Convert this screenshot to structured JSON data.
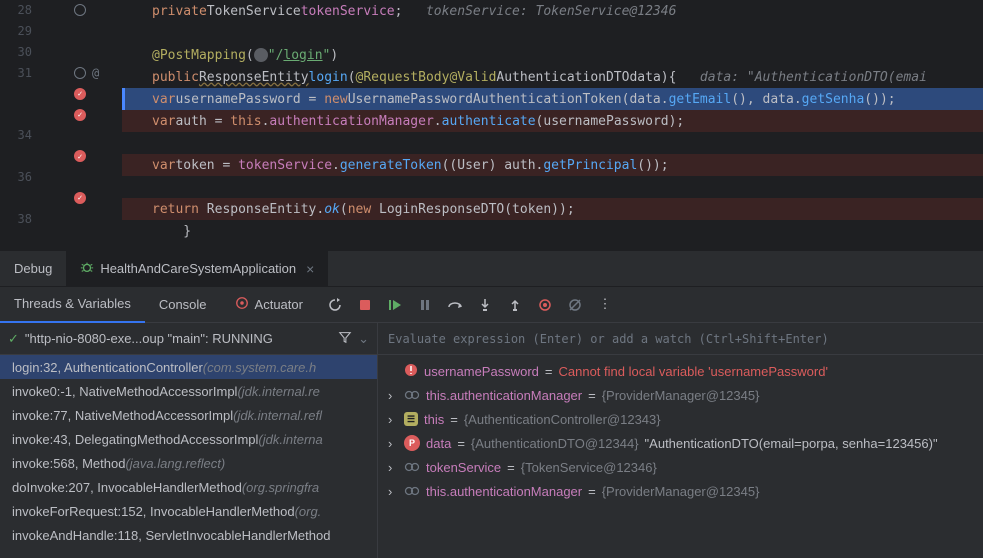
{
  "editor": {
    "lines": [
      {
        "num": "28",
        "html": "    <span class='kw'>private</span> <span class='type'>TokenService</span> <span class='field'>tokenService</span>;   <span class='comment'>tokenService: TokenService@12346</span>",
        "bp": false,
        "icons": [
          "circle"
        ]
      },
      {
        "num": "29",
        "html": "",
        "bp": false,
        "icons": []
      },
      {
        "num": "30",
        "html": "    <span class='anno'>@PostMapping</span>(<span class='globe'></span><span class='str'>\"/<span style='text-decoration:underline'>login</span>\"</span>)",
        "bp": false,
        "icons": []
      },
      {
        "num": "31",
        "html": "    <span class='kw'>public</span> <span class='type underline'>ResponseEntity</span>  <span class='method'>login</span>(<span class='anno'>@RequestBody</span> <span class='anno'>@Valid</span> <span class='type'>AuthenticationDTO</span> <span class='param'>data</span>){   <span class='comment'>data: \"AuthenticationDTO(emai</span>",
        "bp": false,
        "icons": [
          "circle",
          "at"
        ]
      },
      {
        "num": "",
        "html": "        <span class='kw'>var</span> <span class='param'>usernamePassword</span> = <span class='kw'>new</span> <span class='type'>UsernamePasswordAuthenticationToken</span>(<span class='param'>data</span>.<span class='method'>getEmail</span>(), <span class='param'>data</span>.<span class='method'>getSenha</span>()); ",
        "bp": false,
        "current": true,
        "icons": [
          "bpcheck"
        ]
      },
      {
        "num": "",
        "html": "        <span class='kw'>var</span> <span class='param'>auth</span> = <span class='this'>this</span>.<span class='field'>authenticationManager</span>.<span class='method'>authenticate</span>(usernamePassword);",
        "bp": true,
        "icons": [
          "bpcheck"
        ]
      },
      {
        "num": "34",
        "html": "",
        "bp": false,
        "icons": []
      },
      {
        "num": "",
        "html": "        <span class='kw'>var</span> <span class='param'>token</span> = <span class='field'>tokenService</span>.<span class='method'>generateToken</span>((User) auth.<span class='method'>getPrincipal</span>());",
        "bp": true,
        "icons": [
          "bpcheck"
        ]
      },
      {
        "num": "36",
        "html": "",
        "bp": false,
        "icons": []
      },
      {
        "num": "",
        "html": "        <span class='kw'>return</span> ResponseEntity.<span class='method-i'>ok</span>(<span class='kw'>new</span> LoginResponseDTO(token));",
        "bp": true,
        "icons": [
          "bpcheck"
        ]
      },
      {
        "num": "38",
        "html": "    }",
        "bp": false,
        "icons": []
      },
      {
        "num": "",
        "html": "",
        "bp": false,
        "icons": []
      }
    ]
  },
  "debug": {
    "panel_label": "Debug",
    "app_tab": "HealthAndCareSystemApplication",
    "toolbar_tabs": {
      "threads": "Threads & Variables",
      "console": "Console",
      "actuator": "Actuator"
    },
    "thread_status": "\"http-nio-8080-exe...oup \"main\": RUNNING",
    "frames": [
      {
        "text": "login:32, AuthenticationController ",
        "pkg": "(com.system.care.h",
        "active": true
      },
      {
        "text": "invoke0:-1, NativeMethodAccessorImpl ",
        "pkg": "(jdk.internal.re",
        "active": false
      },
      {
        "text": "invoke:77, NativeMethodAccessorImpl ",
        "pkg": "(jdk.internal.refl",
        "active": false
      },
      {
        "text": "invoke:43, DelegatingMethodAccessorImpl ",
        "pkg": "(jdk.interna",
        "active": false
      },
      {
        "text": "invoke:568, Method ",
        "pkg": "(java.lang.reflect)",
        "active": false
      },
      {
        "text": "doInvoke:207, InvocableHandlerMethod ",
        "pkg": "(org.springfra",
        "active": false
      },
      {
        "text": "invokeForRequest:152, InvocableHandlerMethod ",
        "pkg": "(org.",
        "active": false
      },
      {
        "text": "invokeAndHandle:118, ServletInvocableHandlerMethod",
        "pkg": "",
        "active": false
      }
    ],
    "eval_placeholder": "Evaluate expression (Enter) or add a watch (Ctrl+Shift+Enter)",
    "vars": [
      {
        "arrow": false,
        "iconType": "err",
        "name": "usernamePassword",
        "eq": " = ",
        "val": "Cannot find local variable 'usernamePassword'",
        "valClass": "var-err"
      },
      {
        "arrow": true,
        "iconType": "link",
        "name": "this.authenticationManager",
        "eq": " = ",
        "val": "{ProviderManager@12345}",
        "valClass": "var-val"
      },
      {
        "arrow": true,
        "iconType": "this",
        "name": "this",
        "eq": " = ",
        "val": "{AuthenticationController@12343}",
        "valClass": "var-val"
      },
      {
        "arrow": true,
        "iconType": "p",
        "name": "data",
        "eq": " = ",
        "val": "{AuthenticationDTO@12344}",
        "valClass": "var-val",
        "extra": " \"AuthenticationDTO(email=porpa, senha=123456)\""
      },
      {
        "arrow": true,
        "iconType": "link",
        "name": "tokenService",
        "eq": " = ",
        "val": "{TokenService@12346}",
        "valClass": "var-val"
      },
      {
        "arrow": true,
        "iconType": "link",
        "name": "this.authenticationManager",
        "eq": " = ",
        "val": "{ProviderManager@12345}",
        "valClass": "var-val"
      }
    ]
  }
}
